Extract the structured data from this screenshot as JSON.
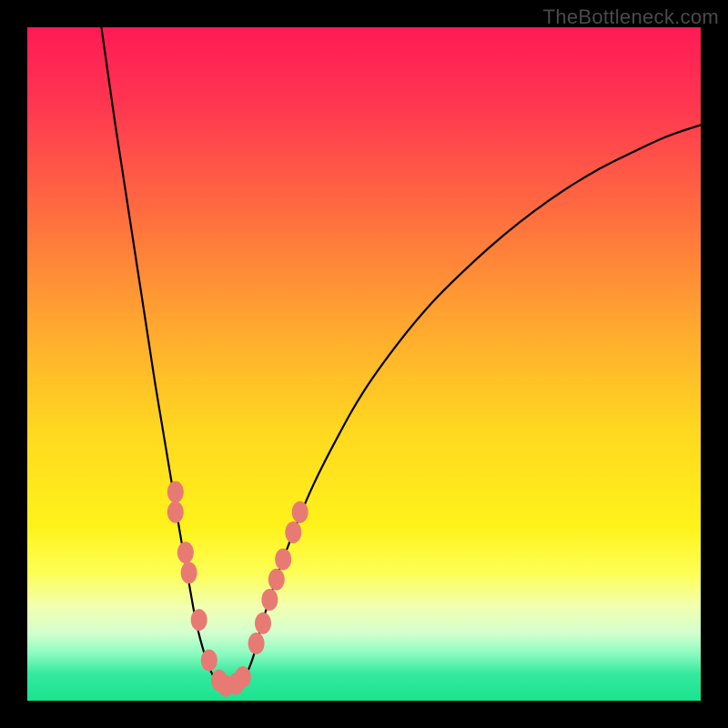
{
  "watermark": "TheBottleneck.com",
  "colors": {
    "gradient_stops": [
      {
        "offset": 0.0,
        "color": "#ff1a55"
      },
      {
        "offset": 0.12,
        "color": "#ff3850"
      },
      {
        "offset": 0.28,
        "color": "#ff6e3f"
      },
      {
        "offset": 0.45,
        "color": "#ffaa2e"
      },
      {
        "offset": 0.6,
        "color": "#ffd820"
      },
      {
        "offset": 0.74,
        "color": "#fff21a"
      },
      {
        "offset": 0.81,
        "color": "#fdff55"
      },
      {
        "offset": 0.86,
        "color": "#f2ffb0"
      },
      {
        "offset": 0.9,
        "color": "#d2ffce"
      },
      {
        "offset": 0.93,
        "color": "#8cfbc0"
      },
      {
        "offset": 0.96,
        "color": "#35e99e"
      },
      {
        "offset": 1.0,
        "color": "#19e490"
      }
    ],
    "curve": "#000000",
    "node": "#e77b74",
    "frame": "#000000"
  },
  "chart_data": {
    "type": "line",
    "title": "",
    "xlabel": "",
    "ylabel": "",
    "xlim": [
      0,
      100
    ],
    "ylim": [
      0,
      100
    ],
    "series": [
      {
        "name": "bottleneck_curve",
        "x": [
          11.0,
          12.0,
          13.0,
          14.0,
          15.0,
          16.0,
          17.0,
          18.0,
          19.0,
          20.0,
          21.0,
          22.0,
          23.0,
          24.0,
          25.0,
          26.0,
          27.0,
          28.0,
          29.0,
          30.0,
          31.0,
          32.0,
          33.0,
          34.0,
          35.0,
          38.0,
          42.0,
          46.0,
          50.0,
          55.0,
          60.0,
          65.0,
          70.0,
          75.0,
          80.0,
          85.0,
          90.0,
          95.0,
          100.0
        ],
        "y": [
          100.0,
          93.0,
          86.0,
          79.5,
          73.0,
          66.5,
          60.0,
          53.5,
          47.0,
          41.0,
          35.0,
          29.0,
          23.0,
          17.5,
          12.0,
          8.0,
          5.0,
          3.0,
          2.2,
          2.0,
          2.2,
          3.0,
          5.0,
          8.0,
          12.0,
          21.0,
          31.0,
          39.0,
          46.0,
          53.0,
          59.0,
          64.0,
          68.5,
          72.5,
          76.0,
          79.0,
          81.5,
          83.8,
          85.5
        ]
      }
    ],
    "nodes": [
      {
        "x": 22.0,
        "y": 31.0
      },
      {
        "x": 22.0,
        "y": 28.0
      },
      {
        "x": 23.5,
        "y": 22.0
      },
      {
        "x": 24.0,
        "y": 19.0
      },
      {
        "x": 25.5,
        "y": 12.0
      },
      {
        "x": 27.0,
        "y": 6.0
      },
      {
        "x": 28.5,
        "y": 3.0
      },
      {
        "x": 29.5,
        "y": 2.2
      },
      {
        "x": 31.0,
        "y": 2.5
      },
      {
        "x": 32.0,
        "y": 3.5
      },
      {
        "x": 34.0,
        "y": 8.5
      },
      {
        "x": 35.0,
        "y": 11.5
      },
      {
        "x": 36.0,
        "y": 15.0
      },
      {
        "x": 37.0,
        "y": 18.0
      },
      {
        "x": 38.0,
        "y": 21.0
      },
      {
        "x": 39.5,
        "y": 25.0
      },
      {
        "x": 40.5,
        "y": 28.0
      }
    ]
  }
}
